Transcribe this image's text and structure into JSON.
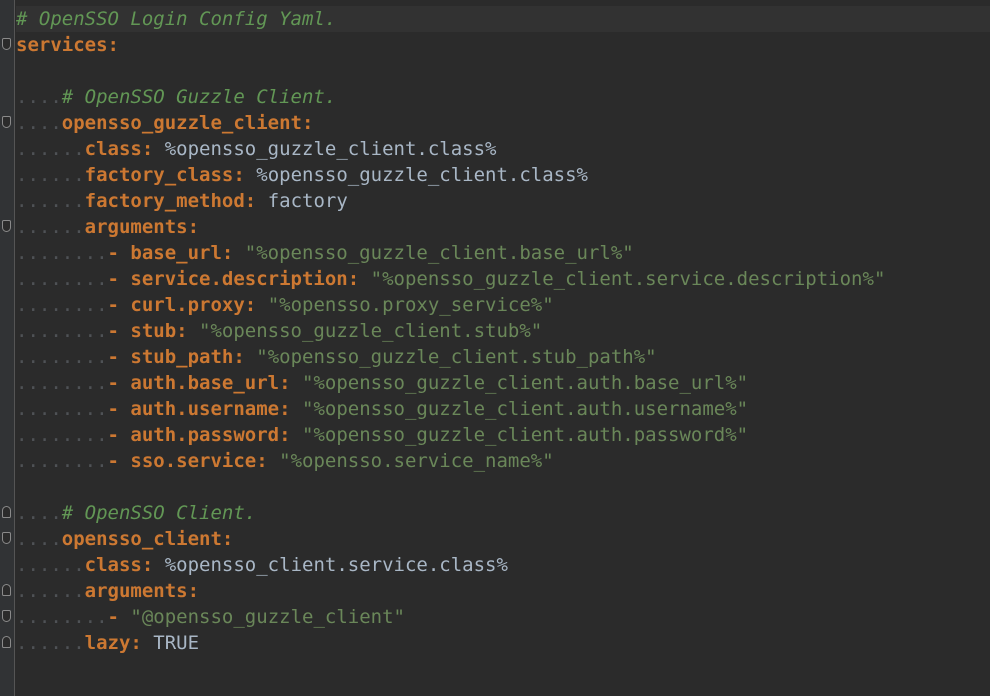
{
  "editor": {
    "lines": [
      {
        "dots": "",
        "comment": "# OpenSSO Login Config Yaml.",
        "key": "",
        "sep": "",
        "value": "",
        "valueKind": ""
      },
      {
        "dots": "",
        "comment": "",
        "key": "services",
        "sep": ":",
        "value": "",
        "valueKind": ""
      },
      {
        "dots": "",
        "comment": "",
        "key": "",
        "sep": "",
        "value": "",
        "valueKind": ""
      },
      {
        "dots": "....",
        "comment": "# OpenSSO Guzzle Client.",
        "key": "",
        "sep": "",
        "value": "",
        "valueKind": ""
      },
      {
        "dots": "....",
        "comment": "",
        "key": "opensso_guzzle_client",
        "sep": ":",
        "value": "",
        "valueKind": ""
      },
      {
        "dots": "......",
        "comment": "",
        "key": "class",
        "sep": ": ",
        "value": "%opensso_guzzle_client.class%",
        "valueKind": "plain"
      },
      {
        "dots": "......",
        "comment": "",
        "key": "factory_class",
        "sep": ": ",
        "value": "%opensso_guzzle_client.class%",
        "valueKind": "plain"
      },
      {
        "dots": "......",
        "comment": "",
        "key": "factory_method",
        "sep": ": ",
        "value": "factory",
        "valueKind": "plain"
      },
      {
        "dots": "......",
        "comment": "",
        "key": "arguments",
        "sep": ":",
        "value": "",
        "valueKind": ""
      },
      {
        "dots": "........",
        "comment": "",
        "key": "- base_url",
        "sep": ": ",
        "value": "\"%opensso_guzzle_client.base_url%\"",
        "valueKind": "str"
      },
      {
        "dots": "........",
        "comment": "",
        "key": "- service.description",
        "sep": ": ",
        "value": "\"%opensso_guzzle_client.service.description%\"",
        "valueKind": "str"
      },
      {
        "dots": "........",
        "comment": "",
        "key": "- curl.proxy",
        "sep": ": ",
        "value": "\"%opensso.proxy_service%\"",
        "valueKind": "str"
      },
      {
        "dots": "........",
        "comment": "",
        "key": "- stub",
        "sep": ": ",
        "value": "\"%opensso_guzzle_client.stub%\"",
        "valueKind": "str"
      },
      {
        "dots": "........",
        "comment": "",
        "key": "- stub_path",
        "sep": ": ",
        "value": "\"%opensso_guzzle_client.stub_path%\"",
        "valueKind": "str"
      },
      {
        "dots": "........",
        "comment": "",
        "key": "- auth.base_url",
        "sep": ": ",
        "value": "\"%opensso_guzzle_client.auth.base_url%\"",
        "valueKind": "str"
      },
      {
        "dots": "........",
        "comment": "",
        "key": "- auth.username",
        "sep": ": ",
        "value": "\"%opensso_guzzle_client.auth.username%\"",
        "valueKind": "str"
      },
      {
        "dots": "........",
        "comment": "",
        "key": "- auth.password",
        "sep": ": ",
        "value": "\"%opensso_guzzle_client.auth.password%\"",
        "valueKind": "str"
      },
      {
        "dots": "........",
        "comment": "",
        "key": "- sso.service",
        "sep": ": ",
        "value": "\"%opensso.service_name%\"",
        "valueKind": "str"
      },
      {
        "dots": "",
        "comment": "",
        "key": "",
        "sep": "",
        "value": "",
        "valueKind": ""
      },
      {
        "dots": "....",
        "comment": "# OpenSSO Client.",
        "key": "",
        "sep": "",
        "value": "",
        "valueKind": ""
      },
      {
        "dots": "....",
        "comment": "",
        "key": "opensso_client",
        "sep": ":",
        "value": "",
        "valueKind": ""
      },
      {
        "dots": "......",
        "comment": "",
        "key": "class",
        "sep": ": ",
        "value": "%opensso_client.service.class%",
        "valueKind": "plain"
      },
      {
        "dots": "......",
        "comment": "",
        "key": "arguments",
        "sep": ":",
        "value": "",
        "valueKind": ""
      },
      {
        "dots": "........",
        "comment": "",
        "key": "-",
        "sep": " ",
        "value": "\"@opensso_guzzle_client\"",
        "valueKind": "str"
      },
      {
        "dots": "......",
        "comment": "",
        "key": "lazy",
        "sep": ": ",
        "value": "TRUE",
        "valueKind": "plain"
      }
    ]
  }
}
